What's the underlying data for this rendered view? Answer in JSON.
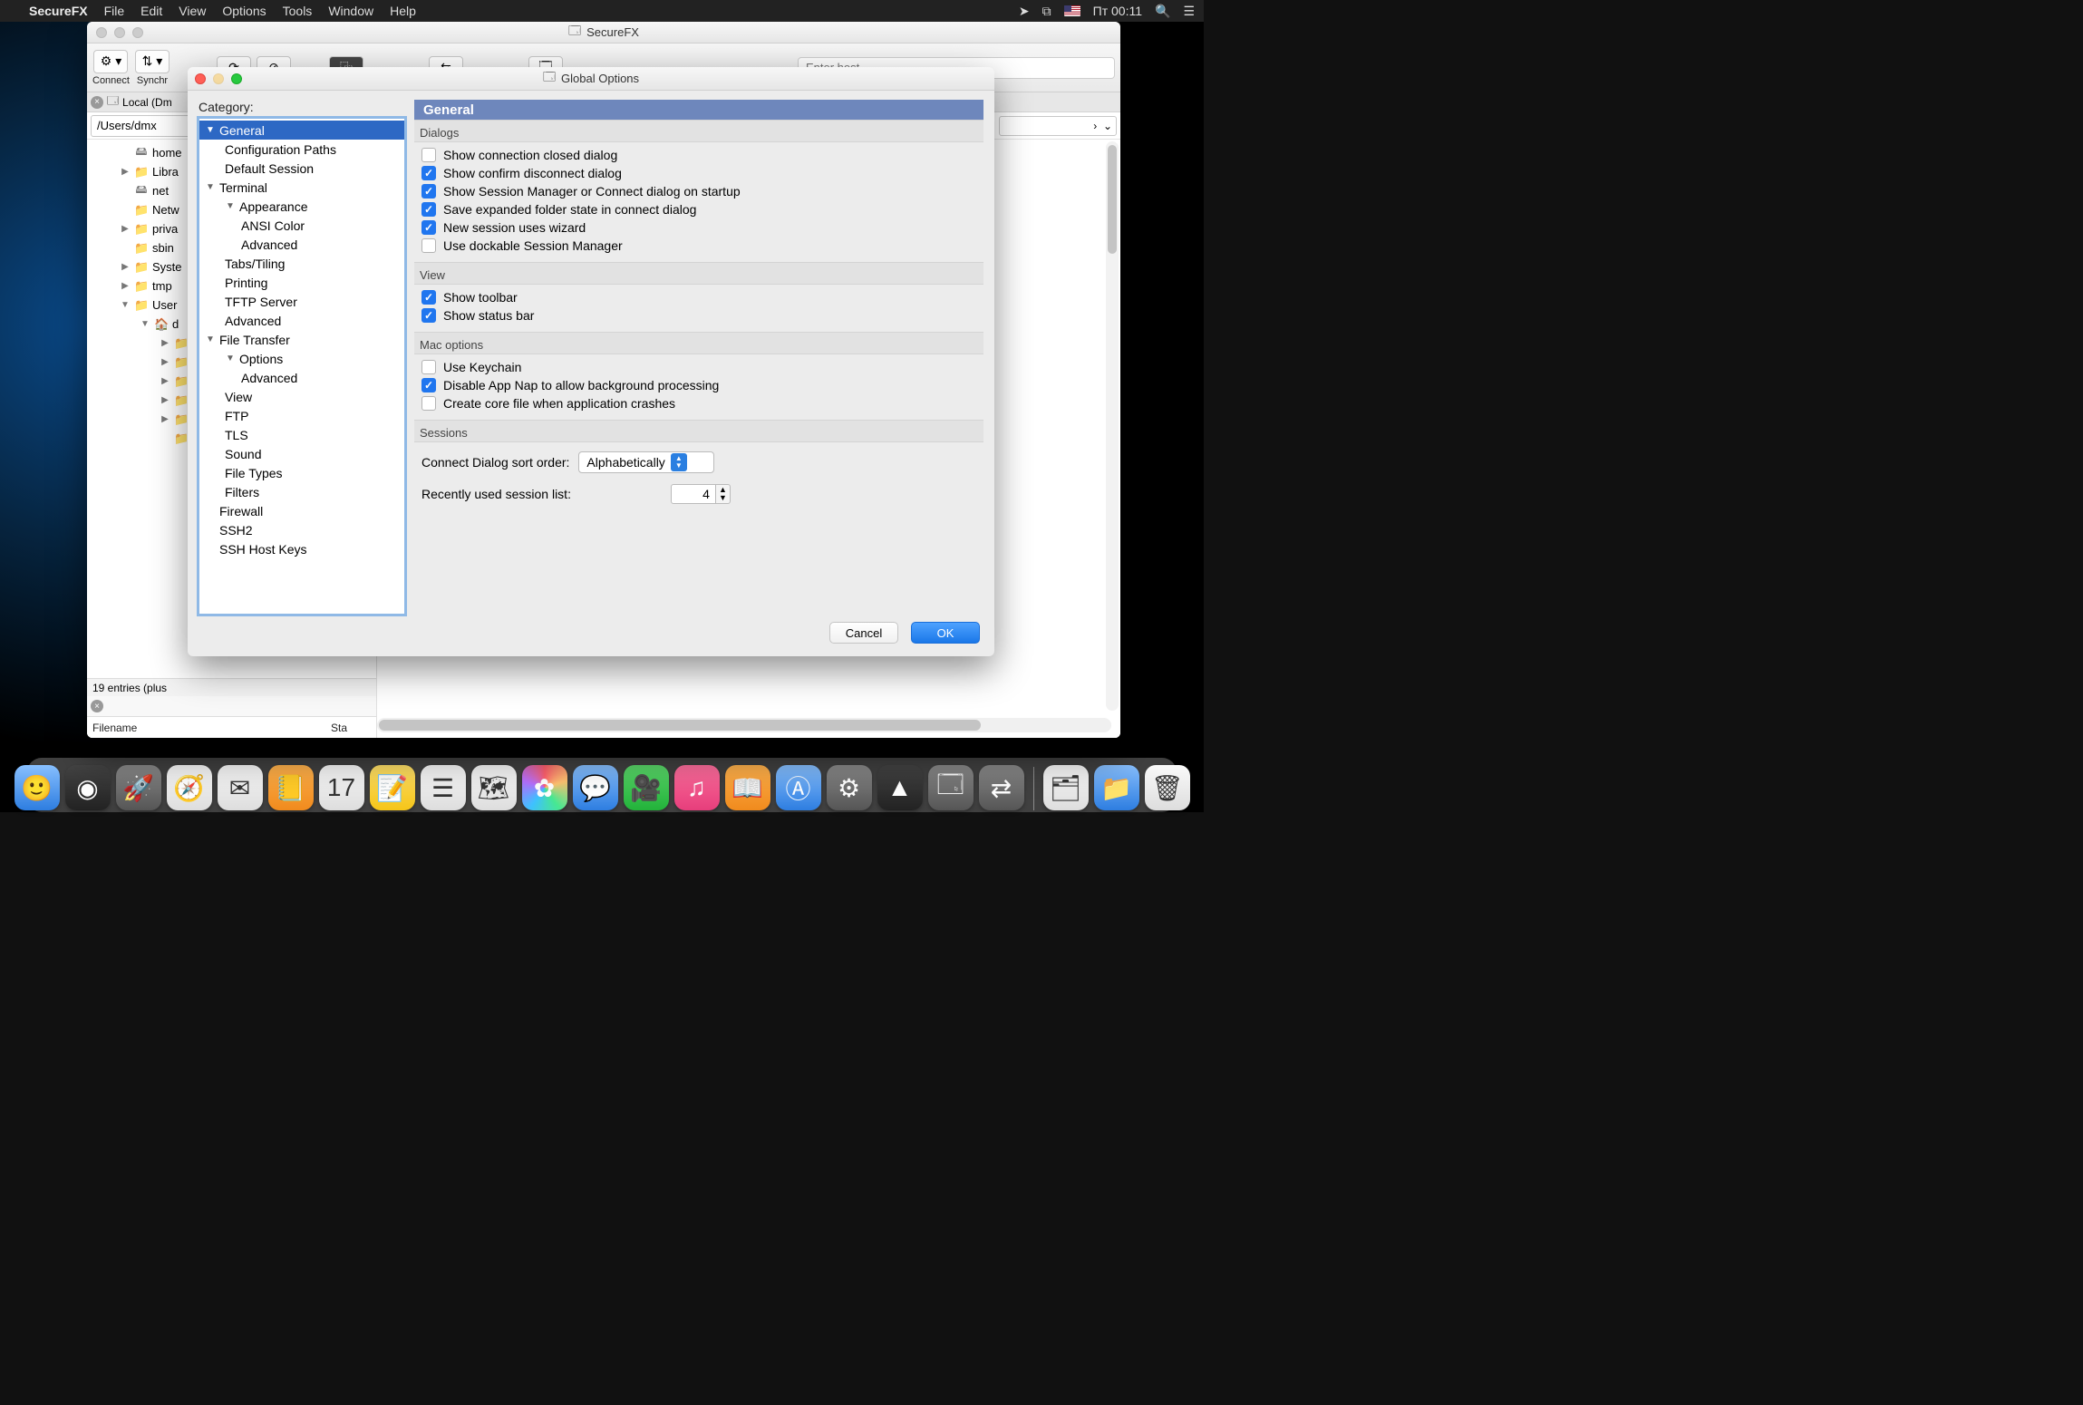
{
  "menubar": {
    "app_name": "SecureFX",
    "items": [
      "File",
      "Edit",
      "View",
      "Options",
      "Tools",
      "Window",
      "Help"
    ],
    "clock": "Пт 00:11"
  },
  "app_window": {
    "title": "SecureFX",
    "toolbar": {
      "connect_label": "Connect",
      "synchronize_label": "Synchr",
      "host_placeholder": "Enter host"
    },
    "tab_label": "Local (Dm",
    "path_value": "/Users/dmx",
    "tree": [
      {
        "name": "home",
        "icon": "drive",
        "indent": 1
      },
      {
        "name": "Libra",
        "icon": "folder",
        "indent": 1,
        "arrow": "▶"
      },
      {
        "name": "net",
        "icon": "drive",
        "indent": 1
      },
      {
        "name": "Netw",
        "icon": "folder",
        "indent": 1
      },
      {
        "name": "priva",
        "icon": "folder",
        "indent": 1,
        "arrow": "▶"
      },
      {
        "name": "sbin",
        "icon": "folder",
        "indent": 1
      },
      {
        "name": "Syste",
        "icon": "folder-x",
        "indent": 1,
        "arrow": "▶"
      },
      {
        "name": "tmp",
        "icon": "folder",
        "indent": 1,
        "arrow": "▶"
      },
      {
        "name": "User",
        "icon": "folder-x",
        "indent": 1,
        "arrow": "▼"
      },
      {
        "name": "d",
        "icon": "home",
        "indent": 2,
        "arrow": "▼"
      }
    ],
    "status_text": "19 entries (plus",
    "list_headers": {
      "filename": "Filename",
      "status": "Sta"
    }
  },
  "modal": {
    "title": "Global Options",
    "category_label": "Category:",
    "panel_title": "General",
    "categories": [
      {
        "label": "General",
        "arrow": "▼",
        "ind": 0,
        "sel": true
      },
      {
        "label": "Configuration Paths",
        "ind": 1
      },
      {
        "label": "Default Session",
        "ind": 1
      },
      {
        "label": "Terminal",
        "arrow": "▼",
        "ind": 0
      },
      {
        "label": "Appearance",
        "arrow": "▼",
        "ind": 1
      },
      {
        "label": "ANSI Color",
        "ind": 2
      },
      {
        "label": "Advanced",
        "ind": 2
      },
      {
        "label": "Tabs/Tiling",
        "ind": 1
      },
      {
        "label": "Printing",
        "ind": 1
      },
      {
        "label": "TFTP Server",
        "ind": 1
      },
      {
        "label": "Advanced",
        "ind": 1
      },
      {
        "label": "File Transfer",
        "arrow": "▼",
        "ind": 0
      },
      {
        "label": "Options",
        "arrow": "▼",
        "ind": 1
      },
      {
        "label": "Advanced",
        "ind": 2
      },
      {
        "label": "View",
        "ind": 1
      },
      {
        "label": "FTP",
        "ind": 1
      },
      {
        "label": "TLS",
        "ind": 1
      },
      {
        "label": "Sound",
        "ind": 1
      },
      {
        "label": "File Types",
        "ind": 1
      },
      {
        "label": "Filters",
        "ind": 1
      },
      {
        "label": "Firewall",
        "ind": 0
      },
      {
        "label": "SSH2",
        "ind": 0
      },
      {
        "label": "SSH Host Keys",
        "ind": 0
      }
    ],
    "sections": {
      "dialogs": {
        "title": "Dialogs",
        "items": [
          {
            "label": "Show connection closed dialog",
            "checked": false
          },
          {
            "label": "Show confirm disconnect dialog",
            "checked": true
          },
          {
            "label": "Show Session Manager or Connect dialog on startup",
            "checked": true
          },
          {
            "label": "Save expanded folder state in connect dialog",
            "checked": true
          },
          {
            "label": "New session uses wizard",
            "checked": true
          },
          {
            "label": "Use dockable Session Manager",
            "checked": false
          }
        ]
      },
      "view": {
        "title": "View",
        "items": [
          {
            "label": "Show toolbar",
            "checked": true
          },
          {
            "label": "Show status bar",
            "checked": true
          }
        ]
      },
      "mac": {
        "title": "Mac options",
        "items": [
          {
            "label": "Use Keychain",
            "checked": false
          },
          {
            "label": "Disable App Nap to allow background processing",
            "checked": true
          },
          {
            "label": "Create core file when application crashes",
            "checked": false
          }
        ]
      },
      "sessions": {
        "title": "Sessions",
        "sort_label": "Connect Dialog sort order:",
        "sort_value": "Alphabetically",
        "recent_label": "Recently used session list:",
        "recent_value": "4"
      }
    },
    "buttons": {
      "cancel": "Cancel",
      "ok": "OK"
    }
  },
  "dock": {
    "items": [
      {
        "name": "finder",
        "glyph": "🙂",
        "cls": "ai"
      },
      {
        "name": "siri",
        "glyph": "◉",
        "cls": "ai dark"
      },
      {
        "name": "launchpad",
        "glyph": "🚀",
        "cls": "ai gray"
      },
      {
        "name": "safari",
        "glyph": "🧭",
        "cls": "ai white"
      },
      {
        "name": "mail",
        "glyph": "✉︎",
        "cls": "ai white"
      },
      {
        "name": "contacts",
        "glyph": "📒",
        "cls": "ai orange"
      },
      {
        "name": "calendar",
        "glyph": "17",
        "cls": "ai white"
      },
      {
        "name": "notes",
        "glyph": "📝",
        "cls": "ai yellow"
      },
      {
        "name": "reminders",
        "glyph": "☰",
        "cls": "ai white"
      },
      {
        "name": "maps",
        "glyph": "🗺",
        "cls": "ai white"
      },
      {
        "name": "photos",
        "glyph": "✿",
        "cls": "ai multi"
      },
      {
        "name": "messages",
        "glyph": "💬",
        "cls": "ai"
      },
      {
        "name": "facetime",
        "glyph": "🎥",
        "cls": "ai green"
      },
      {
        "name": "itunes",
        "glyph": "♫",
        "cls": "ai pink"
      },
      {
        "name": "ibooks",
        "glyph": "📖",
        "cls": "ai orange"
      },
      {
        "name": "appstore",
        "glyph": "Ⓐ",
        "cls": "ai"
      },
      {
        "name": "preferences",
        "glyph": "⚙︎",
        "cls": "ai gray"
      },
      {
        "name": "securefx1",
        "glyph": "▲",
        "cls": "ai dark"
      },
      {
        "name": "securefx2",
        "glyph": "🗔",
        "cls": "ai gray"
      },
      {
        "name": "securefx3",
        "glyph": "⇄",
        "cls": "ai gray"
      }
    ],
    "right_items": [
      {
        "name": "desktop-stack",
        "glyph": "🗂",
        "cls": "ai white"
      },
      {
        "name": "downloads",
        "glyph": "📁",
        "cls": "ai"
      },
      {
        "name": "trash",
        "glyph": "🗑",
        "cls": "ai white"
      }
    ]
  }
}
